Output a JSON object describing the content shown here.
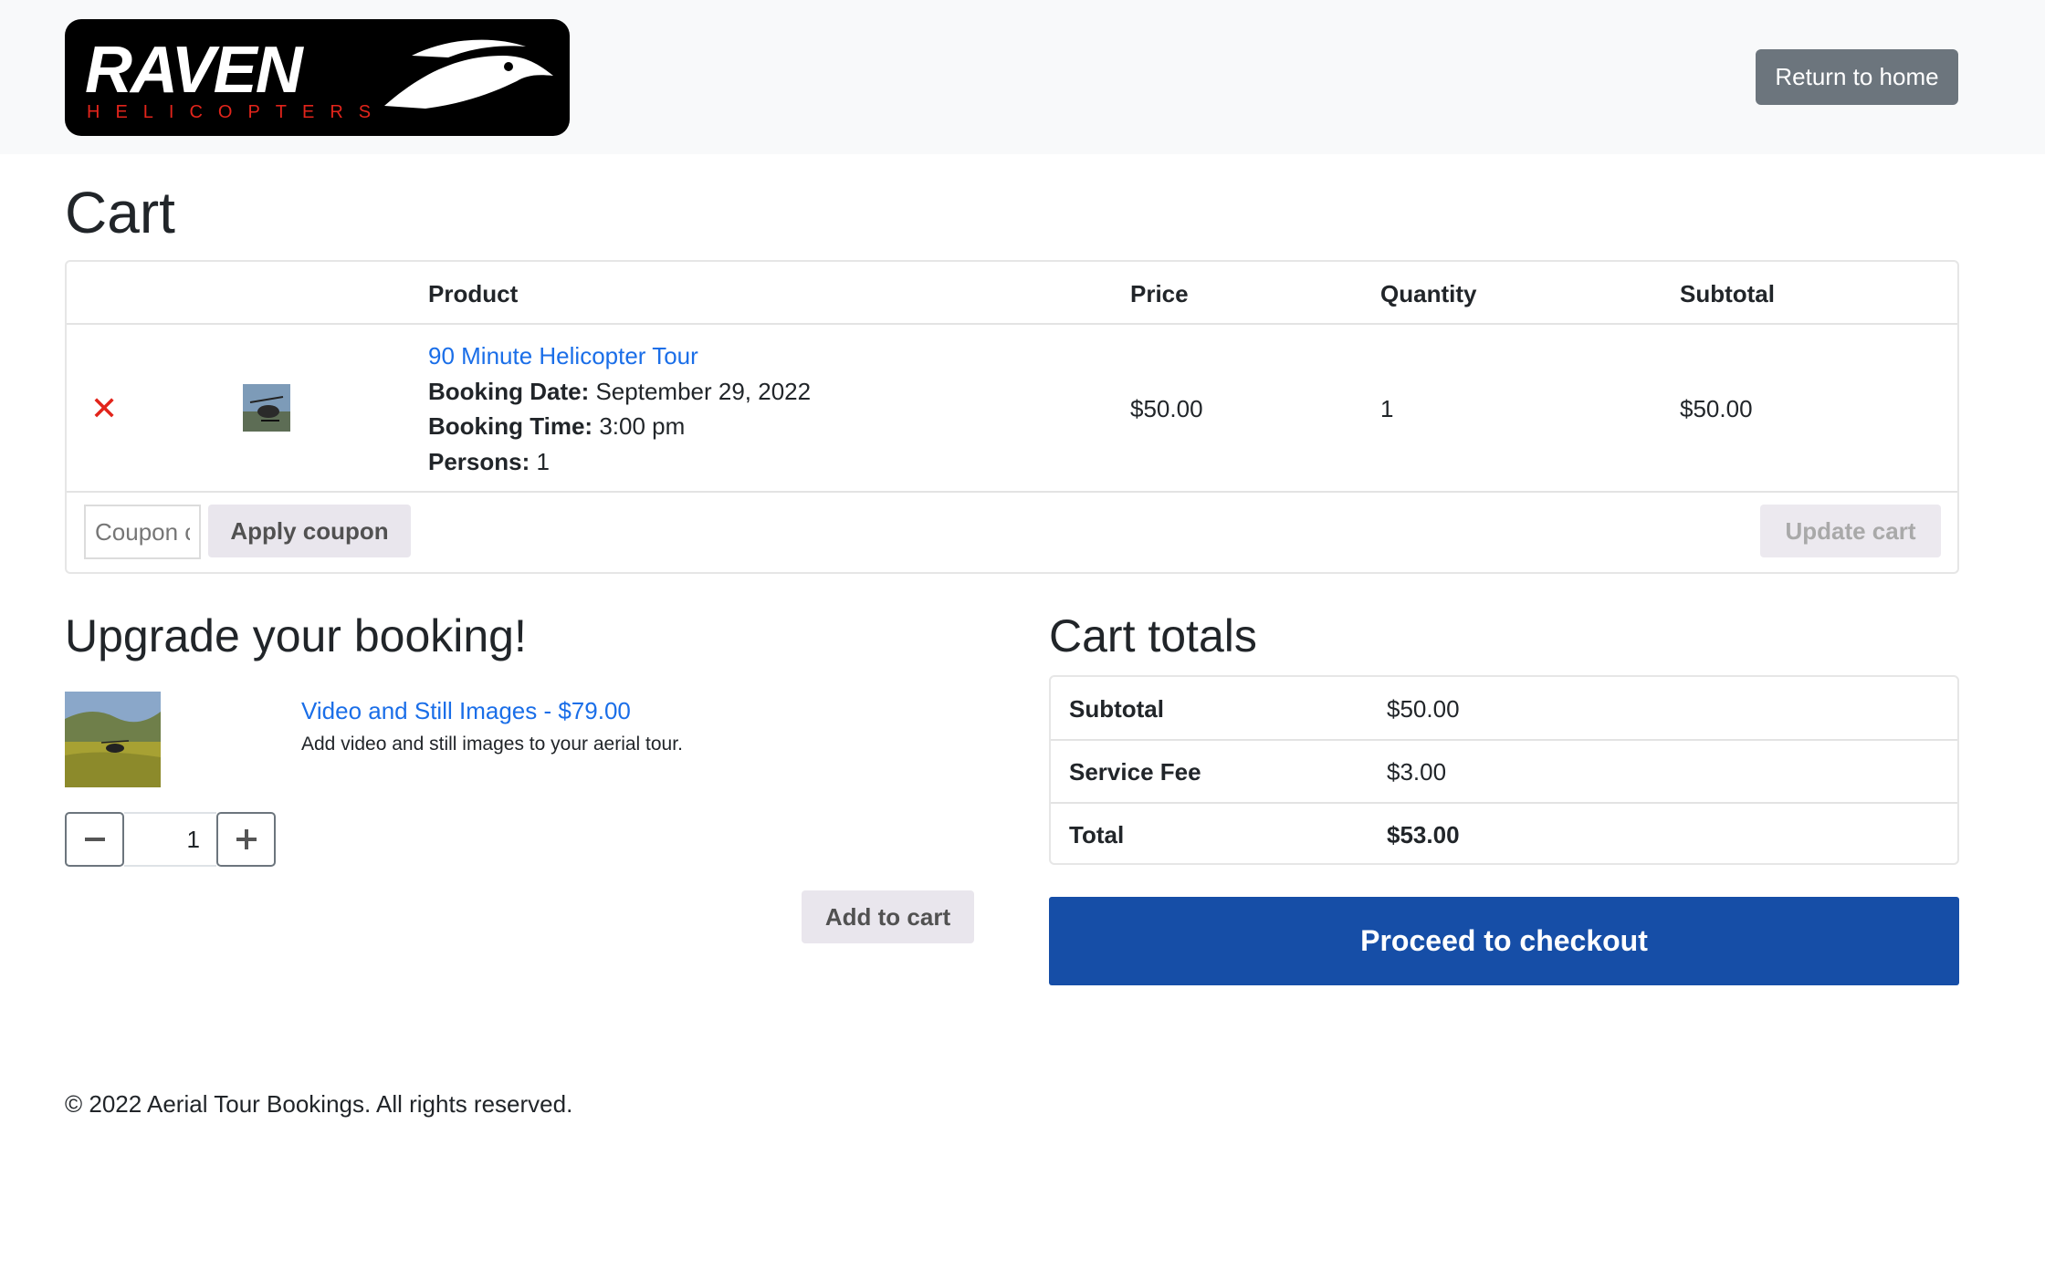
{
  "header": {
    "logo_text": "RAVEN",
    "logo_subtext": "HELICOPTERS",
    "return_label": "Return to home"
  },
  "page": {
    "title": "Cart"
  },
  "cart_table": {
    "headers": [
      "Product",
      "Price",
      "Quantity",
      "Subtotal"
    ],
    "rows": [
      {
        "product_name": "90 Minute Helicopter Tour",
        "booking_date_label": "Booking Date:",
        "booking_date": "September 29, 2022",
        "booking_time_label": "Booking Time:",
        "booking_time": "3:00 pm",
        "persons_label": "Persons:",
        "persons": "1",
        "price": "$50.00",
        "quantity": "1",
        "subtotal": "$50.00"
      }
    ],
    "coupon_placeholder": "Coupon code",
    "apply_label": "Apply coupon",
    "update_label": "Update cart"
  },
  "upsell": {
    "title": "Upgrade your booking!",
    "item_link": "Video and Still Images - $79.00",
    "item_desc": "Add video and still images to your aerial tour.",
    "quantity": "1",
    "add_label": "Add to cart"
  },
  "totals": {
    "title": "Cart totals",
    "rows": [
      {
        "label": "Subtotal",
        "value": "$50.00"
      },
      {
        "label": "Service Fee",
        "value": "$3.00"
      },
      {
        "label": "Total",
        "value": "$53.00"
      }
    ],
    "checkout_label": "Proceed to checkout"
  },
  "footer": {
    "text": "© 2022 Aerial Tour Bookings. All rights reserved."
  },
  "colors": {
    "brand_red": "#e2241b",
    "link_blue": "#1a6ee8",
    "checkout_blue": "#164ea7",
    "secondary_grey": "#6c757d"
  }
}
